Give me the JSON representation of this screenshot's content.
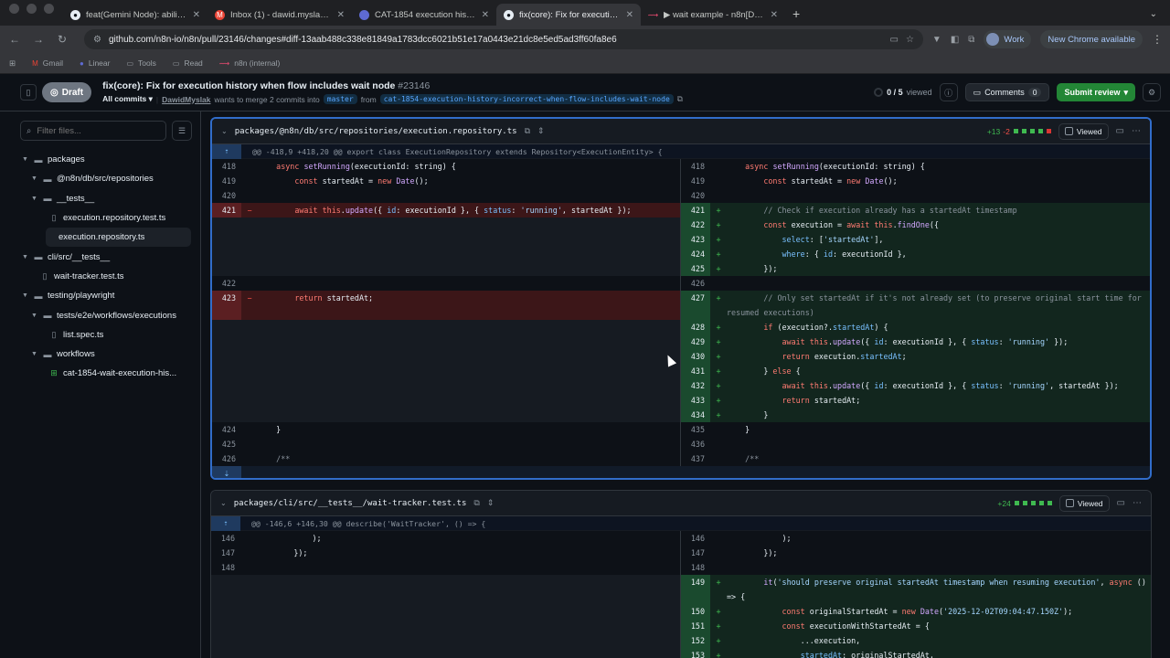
{
  "browser": {
    "tabs": [
      {
        "title": "feat(Gemini Node): ability to",
        "icon": "github-icon"
      },
      {
        "title": "Inbox (1) - dawid.myslak@n8",
        "icon": "gmail-icon"
      },
      {
        "title": "CAT-1854 execution history i",
        "icon": "linear-icon"
      },
      {
        "title": "fix(core): Fix for execution hi",
        "icon": "github-icon",
        "active": true
      },
      {
        "title": "▶ wait example - n8n[DEV]",
        "icon": "n8n-icon"
      }
    ],
    "url": "github.com/n8n-io/n8n/pull/23146/changes#diff-13aab488c338e81849a1783dcc6021b51e17a0443e21dc8e5ed5ad3ff60fa8e6",
    "profile_label": "Work",
    "new_chrome_label": "New Chrome available",
    "bookmarks": [
      "Gmail",
      "Linear",
      "Tools",
      "Read",
      "n8n (internal)"
    ]
  },
  "pr": {
    "status": "Draft",
    "title": "fix(core): Fix for execution history when flow includes wait node",
    "number": "#23146",
    "all_commits": "All commits",
    "author": "DawidMyslak",
    "merge_text": "wants to merge 2 commits into",
    "base_branch": "master",
    "from_text": "from",
    "head_branch": "cat-1854-execution-history-incorrect-when-flow-includes-wait-node",
    "viewed_count": "0 / 5",
    "viewed_label": "viewed",
    "comments_label": "Comments",
    "comments_count": "0",
    "submit_label": "Submit review"
  },
  "tree": {
    "filter_placeholder": "Filter files...",
    "items": [
      {
        "label": "packages",
        "type": "folder",
        "depth": 0
      },
      {
        "label": "@n8n/db/src/repositories",
        "type": "folder",
        "depth": 1
      },
      {
        "label": "__tests__",
        "type": "folder",
        "depth": 2
      },
      {
        "label": "execution.repository.test.ts",
        "type": "file",
        "depth": 3
      },
      {
        "label": "execution.repository.ts",
        "type": "file",
        "depth": 3,
        "selected": true
      },
      {
        "label": "cli/src/__tests__",
        "type": "folder",
        "depth": 1
      },
      {
        "label": "wait-tracker.test.ts",
        "type": "file",
        "depth": 2
      },
      {
        "label": "testing/playwright",
        "type": "folder",
        "depth": 1
      },
      {
        "label": "tests/e2e/workflows/executions",
        "type": "folder",
        "depth": 2
      },
      {
        "label": "list.spec.ts",
        "type": "file",
        "depth": 3
      },
      {
        "label": "workflows",
        "type": "folder",
        "depth": 2
      },
      {
        "label": "cat-1854-wait-execution-his...",
        "type": "file-added",
        "depth": 3
      }
    ]
  },
  "files": [
    {
      "path": "packages/@n8n/db/src/repositories/execution.repository.ts",
      "additions": "+13",
      "deletions": "-2",
      "viewed_label": "Viewed",
      "hunk": "@@ -418,9 +418,20 @@ export class ExecutionRepository extends Repository<ExecutionEntity> {"
    },
    {
      "path": "packages/cli/src/__tests__/wait-tracker.test.ts",
      "additions": "+24",
      "viewed_label": "Viewed",
      "hunk": "@@ -146,6 +146,30 @@ describe('WaitTracker', () => {"
    }
  ],
  "colors": {
    "accent": "#316dca",
    "added": "#3fb950",
    "deleted": "#f85149",
    "submit": "#238636"
  }
}
